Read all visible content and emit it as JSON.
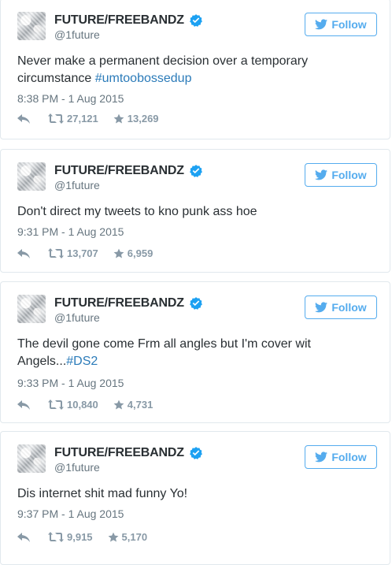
{
  "tweets": [
    {
      "name": "FUTURE/FREEBANDZ",
      "handle": "@1future",
      "follow_label": "Follow",
      "text": "Never make a permanent decision over a temporary circumstance ",
      "hashtag": "#umtoobossedup",
      "time": "8:38 PM - 1 Aug 2015",
      "retweets": "27,121",
      "favorites": "13,269"
    },
    {
      "name": "FUTURE/FREEBANDZ",
      "handle": "@1future",
      "follow_label": "Follow",
      "text": "Don't direct my tweets to kno punk ass hoe",
      "hashtag": "",
      "time": "9:31 PM - 1 Aug 2015",
      "retweets": "13,707",
      "favorites": "6,959"
    },
    {
      "name": "FUTURE/FREEBANDZ",
      "handle": "@1future",
      "follow_label": "Follow",
      "text": "The devil gone come Frm all angles but I'm cover wit Angels...",
      "hashtag": "#DS2",
      "time": "9:33 PM - 1 Aug 2015",
      "retweets": "10,840",
      "favorites": "4,731"
    },
    {
      "name": "FUTURE/FREEBANDZ",
      "handle": "@1future",
      "follow_label": "Follow",
      "text": "Dis internet shit mad funny Yo!",
      "hashtag": "",
      "time": "9:37 PM - 1 Aug 2015",
      "retweets": "9,915",
      "favorites": "5,170"
    }
  ],
  "colors": {
    "accent": "#55acee",
    "hashtag": "#2b7bb9",
    "verified": "#1da1f2",
    "muted": "#66757f",
    "border": "#e1e8ed"
  },
  "icons": [
    "verified-icon",
    "twitter-bird-icon",
    "reply-icon",
    "retweet-icon",
    "favorite-star-icon"
  ]
}
